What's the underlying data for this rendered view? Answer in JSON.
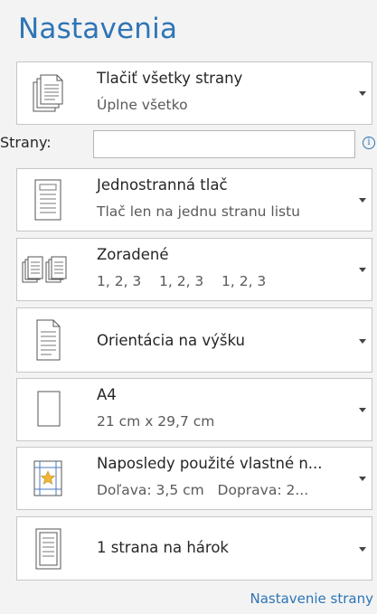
{
  "page_title": "Nastavenia",
  "pages": {
    "label": "Strany:",
    "value": "",
    "placeholder": "",
    "info_icon": "i"
  },
  "settings": [
    {
      "name": "print-range",
      "icon": "pages-icon",
      "title": "Tlačiť všetky strany",
      "subtitle": "Úplne všetko"
    },
    {
      "name": "sides",
      "icon": "single-sided-icon",
      "title": "Jednostranná tlač",
      "subtitle": "Tlač len na jednu stranu listu"
    },
    {
      "name": "collation",
      "icon": "collated-icon",
      "title": "Zoradené",
      "subtitle": "1, 2, 3    1, 2, 3    1, 2, 3"
    },
    {
      "name": "orientation",
      "icon": "portrait-icon",
      "title": "Orientácia na výšku",
      "subtitle": ""
    },
    {
      "name": "paper-size",
      "icon": "paper-size-icon",
      "title": "A4",
      "subtitle": "21 cm x 29,7 cm"
    },
    {
      "name": "margins",
      "icon": "margins-icon",
      "title": "Naposledy použité vlastné n...",
      "subtitle": "Doľava: 3,5 cm   Doprava: 2..."
    },
    {
      "name": "pages-per-sheet",
      "icon": "pages-per-sheet-icon",
      "title": "1 strana na hárok",
      "subtitle": ""
    }
  ],
  "footer_link": "Nastavenie strany",
  "colors": {
    "accent": "#2e75b6",
    "border": "#c6c6c6",
    "background": "#f3f3f3"
  }
}
